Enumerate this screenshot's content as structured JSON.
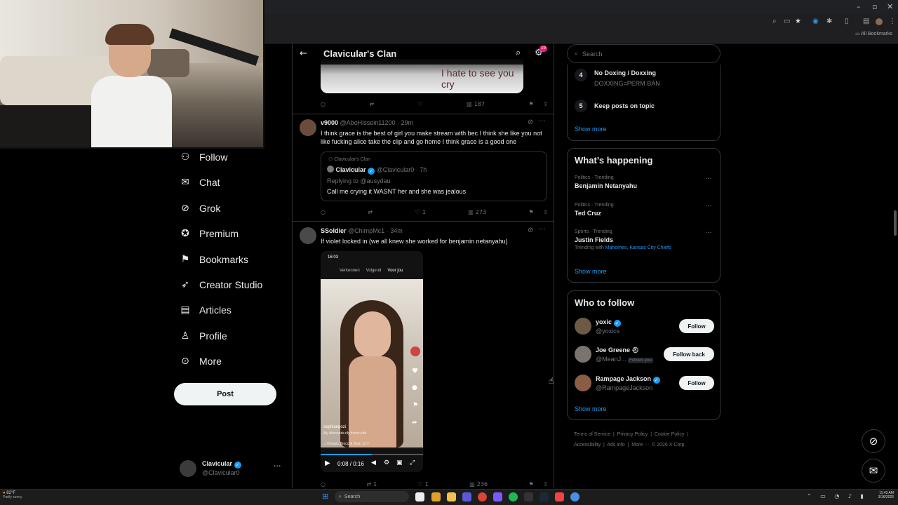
{
  "browser": {
    "bookmarks_label": "All Bookmarks"
  },
  "nav": {
    "items": [
      {
        "label": "Follow",
        "icon": "person-add-icon"
      },
      {
        "label": "Chat",
        "icon": "mail-icon"
      },
      {
        "label": "Grok",
        "icon": "grok-icon"
      },
      {
        "label": "Premium",
        "icon": "verified-icon"
      },
      {
        "label": "Bookmarks",
        "icon": "bookmark-icon"
      },
      {
        "label": "Creator Studio",
        "icon": "rocket-icon"
      },
      {
        "label": "Articles",
        "icon": "article-icon"
      },
      {
        "label": "Profile",
        "icon": "profile-icon"
      },
      {
        "label": "More",
        "icon": "more-circle-icon"
      }
    ],
    "post_label": "Post",
    "account": {
      "name": "Clavicular",
      "handle": "@Clavicular0"
    }
  },
  "main": {
    "title": "Clavicular's Clan",
    "notif_badge": "19",
    "top_image_caption": "I hate to see you cry",
    "top_actions": {
      "views": "187"
    },
    "tweets": [
      {
        "name": "v9000",
        "handle": "@AboHissein11200",
        "time": "· 29m",
        "text": "I think grace is the best of girl you make stream with bec I think she like you not like fucking alice take the clip and go home I think grace is a good one",
        "quote": {
          "community": "Clavicular's Clan",
          "name": "Clavicular",
          "handle": "@Clavicular0",
          "time": "· 7h",
          "replying": "Replying to @ausydau",
          "text": "Call me crying it WASNT her and she was jealous"
        },
        "likes": "1",
        "views": "273"
      },
      {
        "name": "SSoldier",
        "handle": "@ChimpMc1",
        "time": "· 34m",
        "text": "If violet locked in (we all knew she worked for benjamin netanyahu)",
        "video": {
          "status_time": "16:03",
          "tabs": [
            "Verkennen",
            "Volgend",
            "Voor jou"
          ],
          "user": "sophiaegozi",
          "caption": "My diamonds rily frozen tbh",
          "sound": "♫ Devast. Broccoli (feat. Lil Y",
          "time": "0:08 / 0:16"
        },
        "retweets": "1",
        "likes": "1",
        "views": "236"
      }
    ]
  },
  "right": {
    "search_placeholder": "Search",
    "rules": [
      {
        "num": "4",
        "title": "No Doxing / Doxxing",
        "desc": "DOXXING=PERM BAN"
      },
      {
        "num": "5",
        "title": "Keep posts on topic",
        "desc": ""
      }
    ],
    "show_more": "Show more",
    "happening_title": "What’s happening",
    "trends": [
      {
        "context": "Politics · Trending",
        "title": "Benjamin Netanyahu",
        "extra": ""
      },
      {
        "context": "Politics · Trending",
        "title": "Ted Cruz",
        "extra": ""
      },
      {
        "context": "Sports · Trending",
        "title": "Justin Fields",
        "extra_prefix": "Trending with ",
        "extra": "Mahomes, Kansas City Chiefs"
      }
    ],
    "who_title": "Who to follow",
    "who": [
      {
        "name": "yoxic",
        "handle": "@yoxics",
        "button": "Follow",
        "follows_you": ""
      },
      {
        "name": "Joe Greene",
        "handle": "@MeanJ...",
        "button": "Follow back",
        "follows_you": "Follows you"
      },
      {
        "name": "Rampage Jackson",
        "handle": "@RampageJackson",
        "button": "Follow",
        "follows_you": ""
      }
    ],
    "footer": [
      "Terms of Service",
      "|",
      "Privacy Policy",
      "|",
      "Cookie Policy",
      "|",
      "Accessibility",
      "|",
      "Ads info",
      "|",
      "More ···",
      "© 2026 X Corp."
    ]
  },
  "taskbar": {
    "weather_temp": "82°F",
    "weather_desc": "Partly sunny",
    "search": "Search",
    "time": "11:43 AM",
    "date": "3/16/2026"
  },
  "colors": {
    "accent": "#1d9bf0",
    "badge": "#f91880"
  }
}
